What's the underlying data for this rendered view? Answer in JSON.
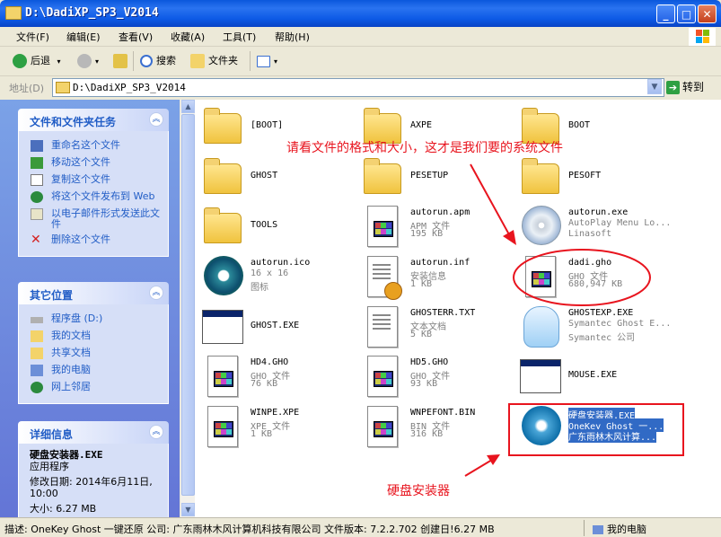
{
  "window": {
    "title": "D:\\DadiXP_SP3_V2014"
  },
  "menu": [
    "文件(F)",
    "编辑(E)",
    "查看(V)",
    "收藏(A)",
    "工具(T)",
    "帮助(H)"
  ],
  "toolbar": {
    "back": "后退",
    "search": "搜索",
    "folders": "文件夹"
  },
  "address": {
    "label": "地址(D)",
    "path": "D:\\DadiXP_SP3_V2014",
    "go": "转到"
  },
  "tasks": {
    "title": "文件和文件夹任务",
    "items": [
      "重命名这个文件",
      "移动这个文件",
      "复制这个文件",
      "将这个文件发布到 Web",
      "以电子邮件形式发送此文件",
      "删除这个文件"
    ]
  },
  "places": {
    "title": "其它位置",
    "items": [
      "程序盘 (D:)",
      "我的文档",
      "共享文档",
      "我的电脑",
      "网上邻居"
    ]
  },
  "details": {
    "title": "详细信息",
    "name": "硬盘安装器.EXE",
    "type": "应用程序",
    "modified": "修改日期: 2014年6月11日, 10:00",
    "size": "大小: 6.27 MB"
  },
  "files": [
    {
      "name": "[BOOT]",
      "icon": "folder-icon"
    },
    {
      "name": "AXPE",
      "icon": "folder-icon"
    },
    {
      "name": "BOOT",
      "icon": "folder-icon"
    },
    {
      "name": "GHOST",
      "icon": "folder-icon"
    },
    {
      "name": "PESETUP",
      "icon": "folder-icon"
    },
    {
      "name": "PESOFT",
      "icon": "folder-icon"
    },
    {
      "name": "TOOLS",
      "icon": "folder-icon"
    },
    {
      "name": "autorun.apm",
      "line1": "APM 文件",
      "line2": "195 KB",
      "icon": "doc-icon"
    },
    {
      "name": "autorun.exe",
      "line1": "AutoPlay Menu Lo...",
      "line2": "Linasoft",
      "icon": "cd-icon"
    },
    {
      "name": "autorun.ico",
      "line1": "16 x 16",
      "line2": "图标",
      "icon": "ico-icon"
    },
    {
      "name": "autorun.inf",
      "line1": "安装信息",
      "line2": "1 KB",
      "icon": "inf-icon"
    },
    {
      "name": "dadi.gho",
      "line1": "GHO 文件",
      "line2": "680,947 KB",
      "icon": "doc-icon"
    },
    {
      "name": "GHOST.EXE",
      "icon": "exe-icon"
    },
    {
      "name": "GHOSTERR.TXT",
      "line1": "文本文档",
      "line2": "5 KB",
      "icon": "txt-icon"
    },
    {
      "name": "GHOSTEXP.EXE",
      "line1": "Symantec Ghost E...",
      "line2": "Symantec 公司",
      "icon": "ghost-icon"
    },
    {
      "name": "HD4.GHO",
      "line1": "GHO 文件",
      "line2": "76 KB",
      "icon": "doc-icon"
    },
    {
      "name": "HD5.GHO",
      "line1": "GHO 文件",
      "line2": "93 KB",
      "icon": "doc-icon"
    },
    {
      "name": "MOUSE.EXE",
      "icon": "exe-icon"
    },
    {
      "name": "WINPE.XPE",
      "line1": "XPE 文件",
      "line2": "1 KB",
      "icon": "doc-icon"
    },
    {
      "name": "WNPEFONT.BIN",
      "line1": "BIN 文件",
      "line2": "316 KB",
      "icon": "doc-icon"
    },
    {
      "name": "硬盘安装器.EXE",
      "line1": "OneKey Ghost 一...",
      "line2": "广东雨林木风计算...",
      "icon": "onekey-icon",
      "selected": true
    }
  ],
  "annotations": {
    "top": "请看文件的格式和大小，这才是我们要的系统文件",
    "bottom": "硬盘安装器"
  },
  "status": {
    "text": "描述: OneKey Ghost 一键还原 公司: 广东雨林木风计算机科技有限公司 文件版本: 7.2.2.702 创建日!6.27 MB",
    "location": "我的电脑"
  },
  "colors": {
    "accent": "#e8141e",
    "selection": "#316ac5",
    "titlebar": "#0a58dc"
  }
}
